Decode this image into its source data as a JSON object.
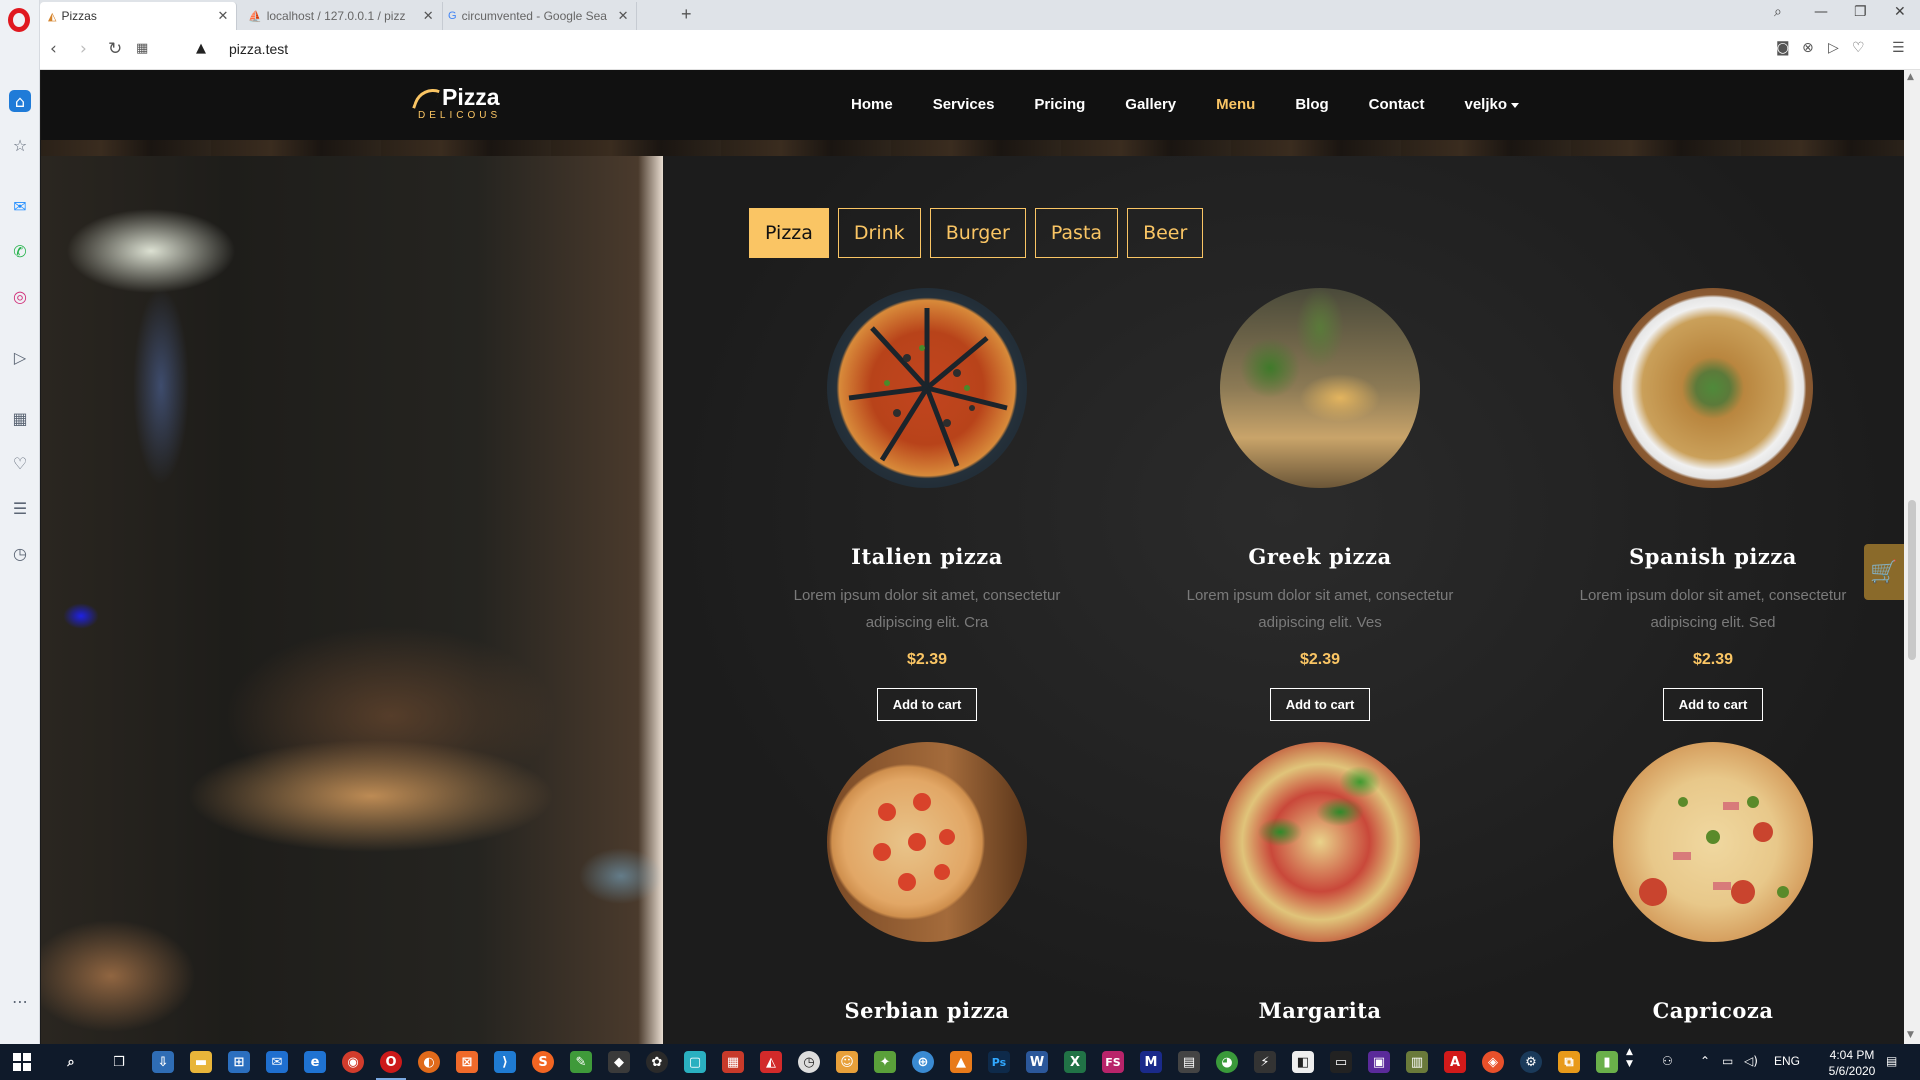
{
  "browser": {
    "tabs": [
      {
        "title": "Pizzas",
        "active": true
      },
      {
        "title": "localhost / 127.0.0.1 / pizz",
        "active": false
      },
      {
        "title": "circumvented - Google Sea",
        "active": false
      }
    ],
    "new_tab": "+",
    "url": "pizza.test"
  },
  "site": {
    "logo_title": "Pizza",
    "logo_subtitle": "DELICOUS",
    "nav": [
      "Home",
      "Services",
      "Pricing",
      "Gallery",
      "Menu",
      "Blog",
      "Contact",
      "veljko"
    ],
    "active_nav": "Menu",
    "categories": [
      "Pizza",
      "Drink",
      "Burger",
      "Pasta",
      "Beer"
    ],
    "active_category": "Pizza",
    "items": [
      {
        "name": "Italien pizza",
        "description": "Lorem ipsum dolor sit amet, consectetur adipiscing elit. Cra",
        "price": "$2.39",
        "button": "Add to cart"
      },
      {
        "name": "Greek pizza",
        "description": "Lorem ipsum dolor sit amet, consectetur adipiscing elit. Ves",
        "price": "$2.39",
        "button": "Add to cart"
      },
      {
        "name": "Spanish pizza",
        "description": "Lorem ipsum dolor sit amet, consectetur adipiscing elit. Sed",
        "price": "$2.39",
        "button": "Add to cart"
      },
      {
        "name": "Serbian pizza"
      },
      {
        "name": "Margarita"
      },
      {
        "name": "Capricoza"
      }
    ]
  },
  "taskbar": {
    "language": "ENG",
    "time": "4:04 PM",
    "date": "5/6/2020"
  },
  "colors": {
    "accent": "#fac564",
    "nav_bg": "#111111",
    "opera_red": "#e0181f"
  }
}
